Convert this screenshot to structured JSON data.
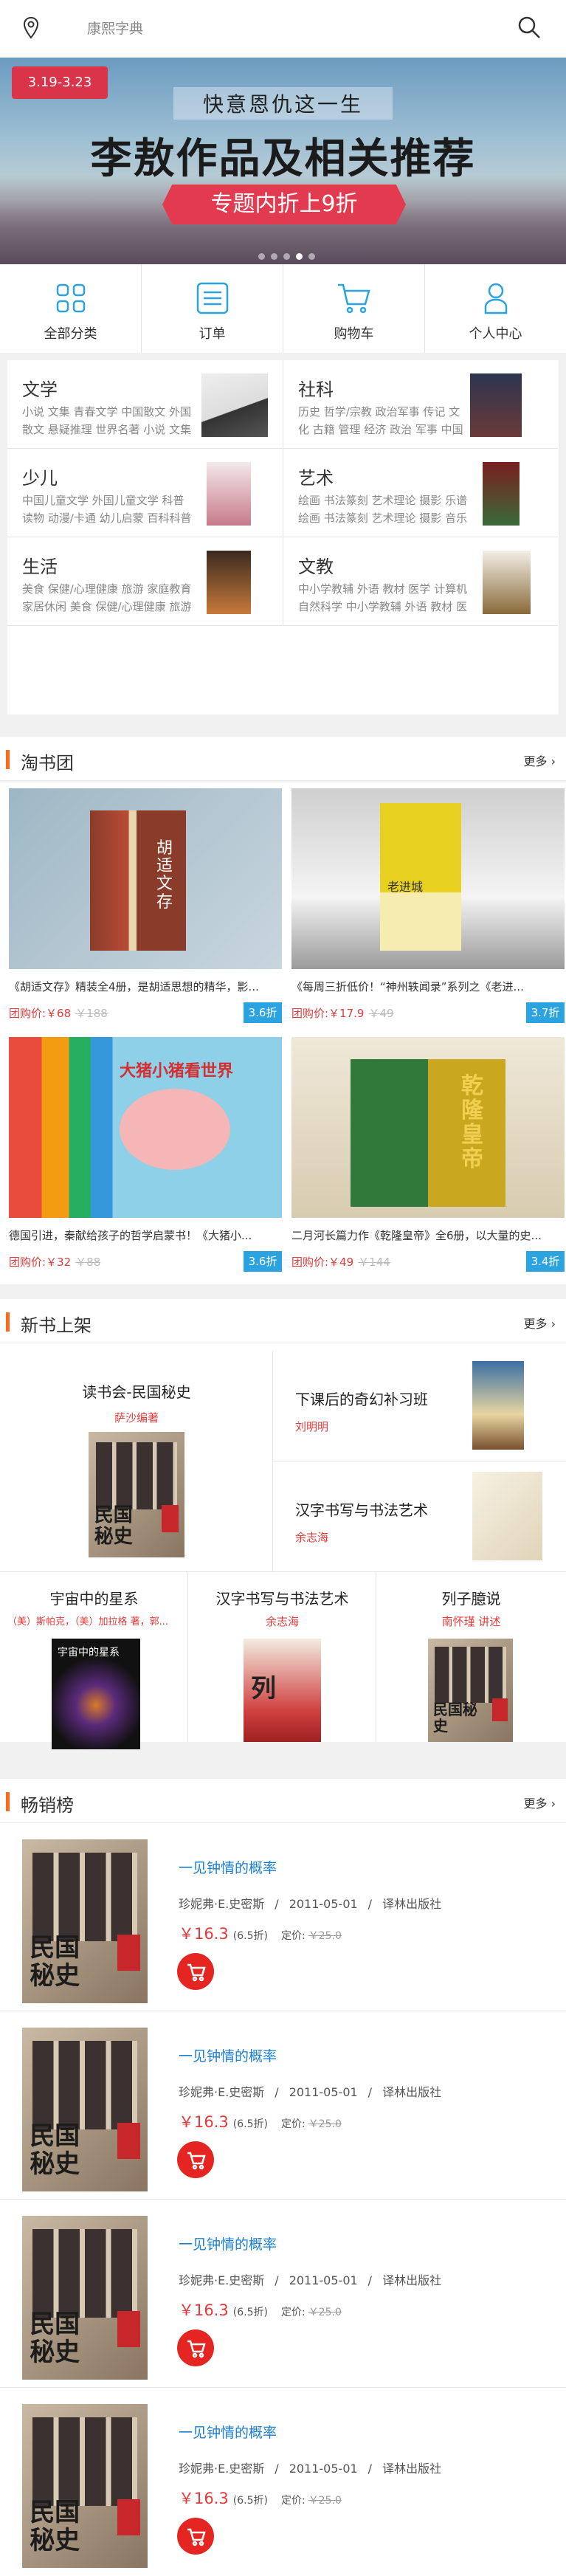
{
  "topbar": {
    "location_icon": "location-pin-icon",
    "search_placeholder": "康熙字典",
    "search_icon": "search-icon"
  },
  "banner": {
    "date_badge": "3.19-3.23",
    "subtitle": "快意恩仇这一生",
    "title": "李敖作品及相关推荐",
    "ribbon": "专题内折上9折",
    "slide_count": 5,
    "active_slide": 3
  },
  "nav": [
    {
      "label": "全部分类",
      "icon": "grid-icon"
    },
    {
      "label": "订单",
      "icon": "order-list-icon"
    },
    {
      "label": "购物车",
      "icon": "cart-icon"
    },
    {
      "label": "个人中心",
      "icon": "user-icon"
    }
  ],
  "categories": [
    {
      "title": "文学",
      "text": "小说 文集 青春文学 中国散文 外国散文 悬疑推理 世界名著 小说 文集 青春文学..."
    },
    {
      "title": "社科",
      "text": "历史 哲学/宗教 政治军事 传记 文化 古籍 管理 经济 政治 军事 中国政治 国际..."
    },
    {
      "title": "少儿",
      "text": "中国儿童文学 外国儿童文学 科普读物 动漫/卡通 幼儿启蒙 百科科普 百科 历史读..."
    },
    {
      "title": "艺术",
      "text": "绘画 书法篆刻 艺术理论 摄影 乐谱 绘画 书法篆刻 艺术理论 摄影 音乐"
    },
    {
      "title": "生活",
      "text": "美食 保健/心理健康 旅游 家庭教育 家居休闲 美食 保健/心理健康 旅游 家庭教..."
    },
    {
      "title": "文教",
      "text": "中小学教辅 外语 教材 医学 计算机 自然科学 中小学教辅 外语 教材 医学 计算..."
    }
  ],
  "group_buy": {
    "title": "淘书团",
    "more": "更多",
    "items": [
      {
        "desc": "《胡适文存》精装全4册，是胡适思想的精华，影...",
        "price": "团购价:￥68",
        "orig": "￥188",
        "discount": "3.6折",
        "cover_text": "胡适文存"
      },
      {
        "desc": "《每周三折低价！“神州轶闻录”系列之《老进...",
        "price": "团购价:￥17.9",
        "orig": "￥49",
        "discount": "3.7折",
        "cover_text": "老进城"
      },
      {
        "desc": "德国引进，秦献给孩子的哲学启蒙书！《大猪小...",
        "price": "团购价:￥32",
        "orig": "￥88",
        "discount": "3.6折",
        "cover_text": "大猪小猪看世界"
      },
      {
        "desc": "二月河长篇力作《乾隆皇帝》全6册，以大量的史...",
        "price": "团购价:￥49",
        "orig": "￥144",
        "discount": "3.4折",
        "cover_text": "乾隆皇帝"
      }
    ]
  },
  "new_books": {
    "title": "新书上架",
    "more": "更多",
    "featured": {
      "title": "读书会-民国秘史",
      "author": "萨沙编著"
    },
    "right": [
      {
        "title": "下课后的奇幻补习班",
        "author": "刘明明"
      },
      {
        "title": "汉字书写与书法艺术",
        "author": "余志海"
      }
    ],
    "bottom": [
      {
        "title": "宇宙中的星系",
        "author": "（美）斯帕克，（美）加拉格 著，郭...",
        "cover_text": "宇宙中的星系"
      },
      {
        "title": "汉字书写与书法艺术",
        "author": "余志海",
        "cover_text": "列"
      },
      {
        "title": "列子臆说",
        "author": "南怀瑾 讲述",
        "cover_text": "民国秘史"
      }
    ]
  },
  "bestsellers": {
    "title": "畅销榜",
    "more": "更多",
    "items": [
      {
        "title": "一见钟情的概率",
        "author": "珍妮弗·E.史密斯",
        "date": "2011-05-01",
        "publisher": "译林出版社",
        "price": "￥16.3",
        "discount": "(6.5折)",
        "list_label": "定价:",
        "list_price": "￥25.0",
        "cover_text": "民国秘史"
      },
      {
        "title": "一见钟情的概率",
        "author": "珍妮弗·E.史密斯",
        "date": "2011-05-01",
        "publisher": "译林出版社",
        "price": "￥16.3",
        "discount": "(6.5折)",
        "list_label": "定价:",
        "list_price": "￥25.0",
        "cover_text": "民国秘史"
      },
      {
        "title": "一见钟情的概率",
        "author": "珍妮弗·E.史密斯",
        "date": "2011-05-01",
        "publisher": "译林出版社",
        "price": "￥16.3",
        "discount": "(6.5折)",
        "list_label": "定价:",
        "list_price": "￥25.0",
        "cover_text": "民国秘史"
      },
      {
        "title": "一见钟情的概率",
        "author": "珍妮弗·E.史密斯",
        "date": "2011-05-01",
        "publisher": "译林出版社",
        "price": "￥16.3",
        "discount": "(6.5折)",
        "list_label": "定价:",
        "list_price": "￥25.0",
        "cover_text": "民国秘史"
      }
    ]
  },
  "colors": {
    "accent": "#ff6a1a",
    "price": "#e43a3a",
    "discount_badge": "#2aa3e0",
    "nav_icon": "#2aa3e0",
    "cart_button": "#e52521"
  }
}
